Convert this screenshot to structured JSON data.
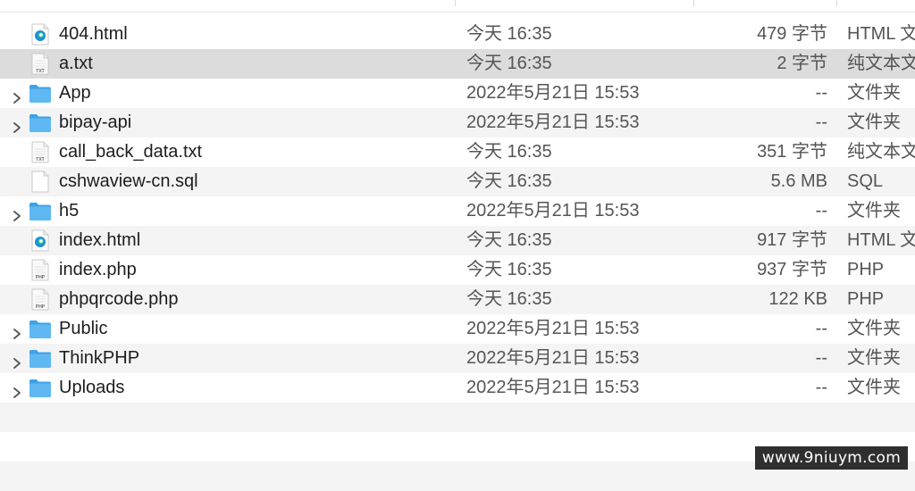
{
  "files": [
    {
      "name": "404.html",
      "date": "今天 16:35",
      "size": "479 字节",
      "kind": "HTML 文",
      "type": "html",
      "folder": false,
      "icon": "edge-html-icon"
    },
    {
      "name": "a.txt",
      "date": "今天 16:35",
      "size": "2 字节",
      "kind": "纯文本文",
      "type": "txt",
      "folder": false,
      "selected": true,
      "icon": "txt-file-icon",
      "badge": "TXT"
    },
    {
      "name": "App",
      "date": "2022年5月21日 15:53",
      "size": "--",
      "kind": "文件夹",
      "type": "folder",
      "folder": true,
      "icon": "folder-icon"
    },
    {
      "name": "bipay-api",
      "date": "2022年5月21日 15:53",
      "size": "--",
      "kind": "文件夹",
      "type": "folder",
      "folder": true,
      "icon": "folder-icon"
    },
    {
      "name": "call_back_data.txt",
      "date": "今天 16:35",
      "size": "351 字节",
      "kind": "纯文本文",
      "type": "txt",
      "folder": false,
      "icon": "txt-file-icon",
      "badge": "TXT"
    },
    {
      "name": "cshwaview-cn.sql",
      "date": "今天 16:35",
      "size": "5.6 MB",
      "kind": "SQL",
      "type": "blank",
      "folder": false,
      "icon": "blank-file-icon"
    },
    {
      "name": "h5",
      "date": "2022年5月21日 15:53",
      "size": "--",
      "kind": "文件夹",
      "type": "folder",
      "folder": true,
      "icon": "folder-icon"
    },
    {
      "name": "index.html",
      "date": "今天 16:35",
      "size": "917 字节",
      "kind": "HTML 文",
      "type": "html",
      "folder": false,
      "icon": "edge-html-icon"
    },
    {
      "name": "index.php",
      "date": "今天 16:35",
      "size": "937 字节",
      "kind": "PHP",
      "type": "php",
      "folder": false,
      "icon": "php-file-icon",
      "badge": "PHP"
    },
    {
      "name": "phpqrcode.php",
      "date": "今天 16:35",
      "size": "122 KB",
      "kind": "PHP",
      "type": "php",
      "folder": false,
      "icon": "php-file-icon",
      "badge": "PHP"
    },
    {
      "name": "Public",
      "date": "2022年5月21日 15:53",
      "size": "--",
      "kind": "文件夹",
      "type": "folder",
      "folder": true,
      "icon": "folder-icon"
    },
    {
      "name": "ThinkPHP",
      "date": "2022年5月21日 15:53",
      "size": "--",
      "kind": "文件夹",
      "type": "folder",
      "folder": true,
      "icon": "folder-icon"
    },
    {
      "name": "Uploads",
      "date": "2022年5月21日 15:53",
      "size": "--",
      "kind": "文件夹",
      "type": "folder",
      "folder": true,
      "icon": "folder-icon"
    }
  ],
  "watermark": "www.9niuym.com",
  "colors": {
    "folder": "#5fb8f2",
    "folder_dark": "#3ea2e6",
    "selected_row": "#dcdcdc",
    "alt_row": "#f4f4f5"
  }
}
